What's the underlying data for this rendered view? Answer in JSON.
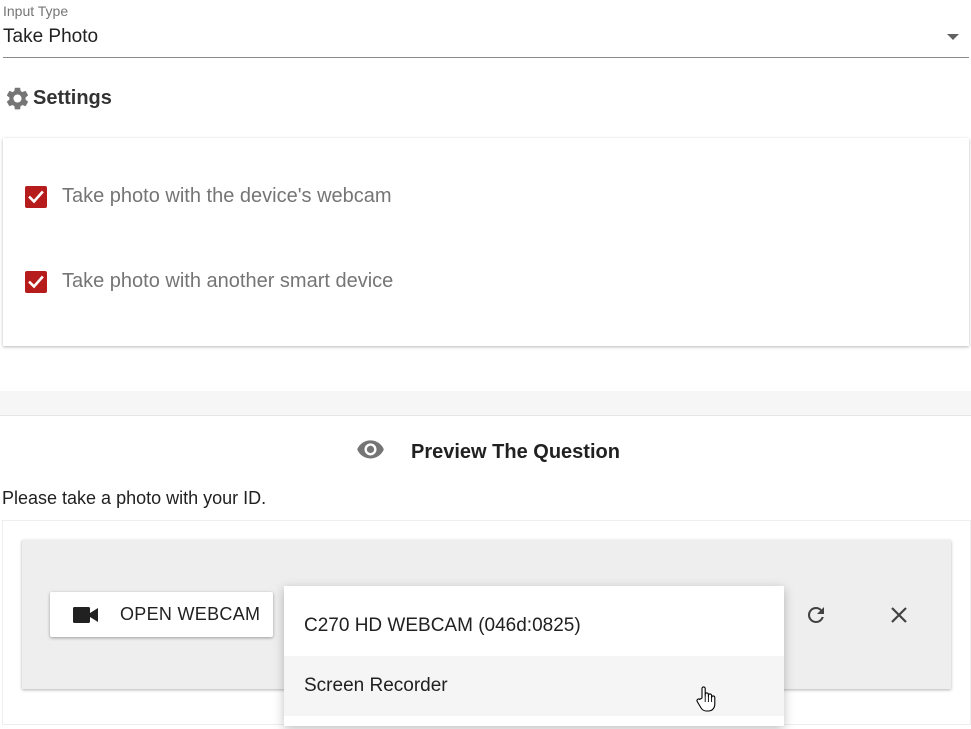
{
  "input_type": {
    "label": "Input Type",
    "value": "Take Photo"
  },
  "settings": {
    "title": "Settings",
    "options": [
      {
        "label": "Take photo with the device's webcam",
        "checked": true
      },
      {
        "label": "Take photo with another smart device",
        "checked": true
      }
    ]
  },
  "preview": {
    "title": "Preview The Question",
    "question": "Please take a photo with your ID.",
    "open_webcam_label": "OPEN WEBCAM",
    "camera_options": [
      "C270 HD WEBCAM (046d:0825)",
      "Screen Recorder"
    ]
  },
  "colors": {
    "checkbox": "#b71c1c",
    "panel": "#eeeeee"
  },
  "icons": {
    "settings": "gear-icon",
    "preview": "eye-icon",
    "webcam": "videocam-icon",
    "refresh": "refresh-icon",
    "close": "close-icon",
    "dropdown": "caret-down-icon"
  }
}
